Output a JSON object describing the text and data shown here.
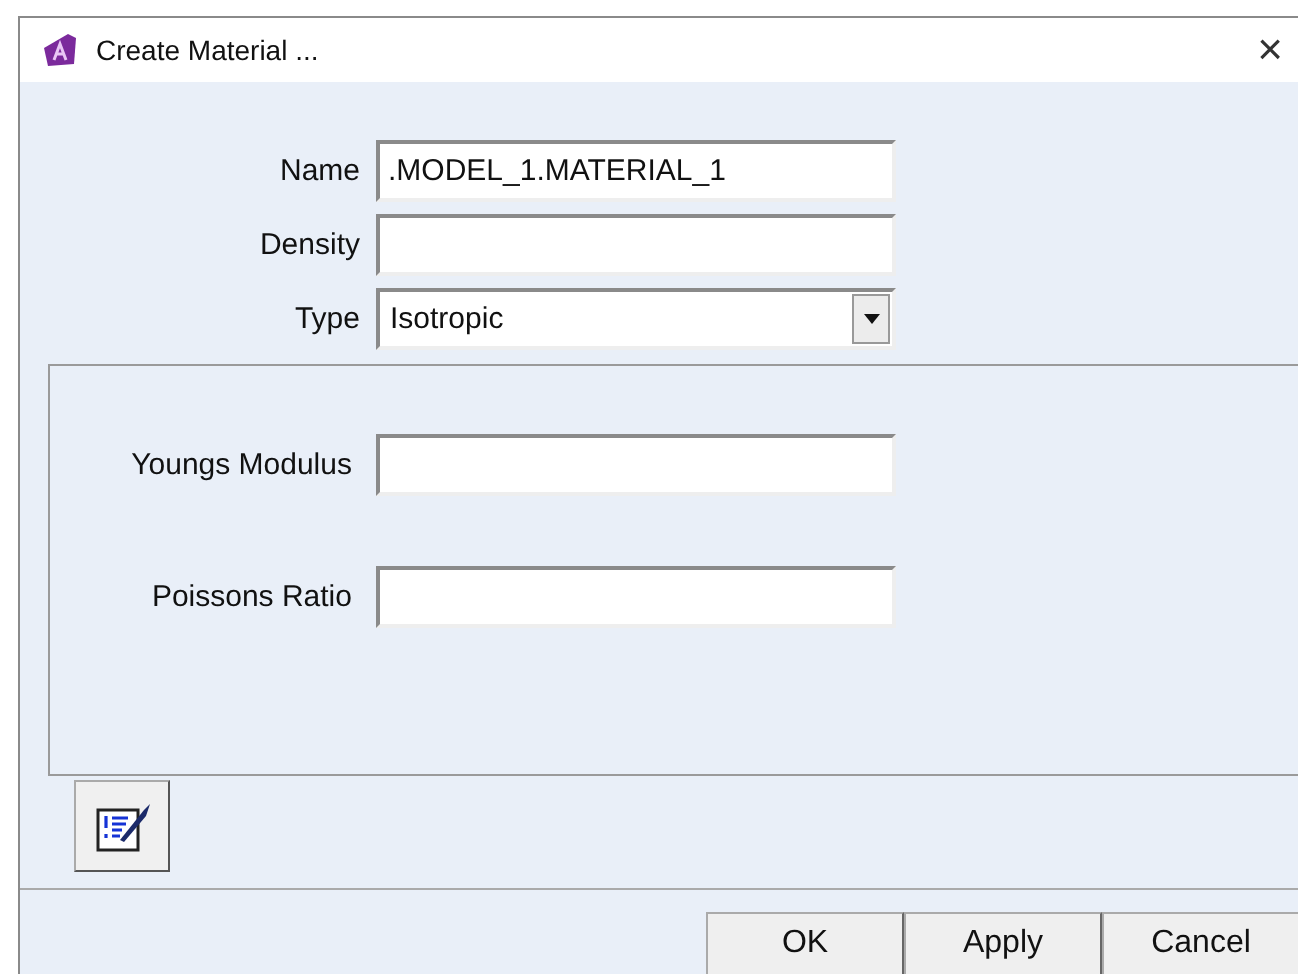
{
  "window": {
    "title": "Create Material ...",
    "close": "×"
  },
  "fields": [
    {
      "kind": "text",
      "label": "Name",
      "value": ".MODEL_1.MATERIAL_1"
    },
    {
      "kind": "text",
      "label": "Density"
    },
    {
      "kind": "select",
      "label": "Type",
      "value": "Isotropic"
    }
  ],
  "properties": [
    {
      "label": "Youngs Modulus"
    },
    {
      "label": "Poissons Ratio"
    }
  ],
  "buttons": [
    "OK",
    "Apply",
    "Cancel"
  ]
}
